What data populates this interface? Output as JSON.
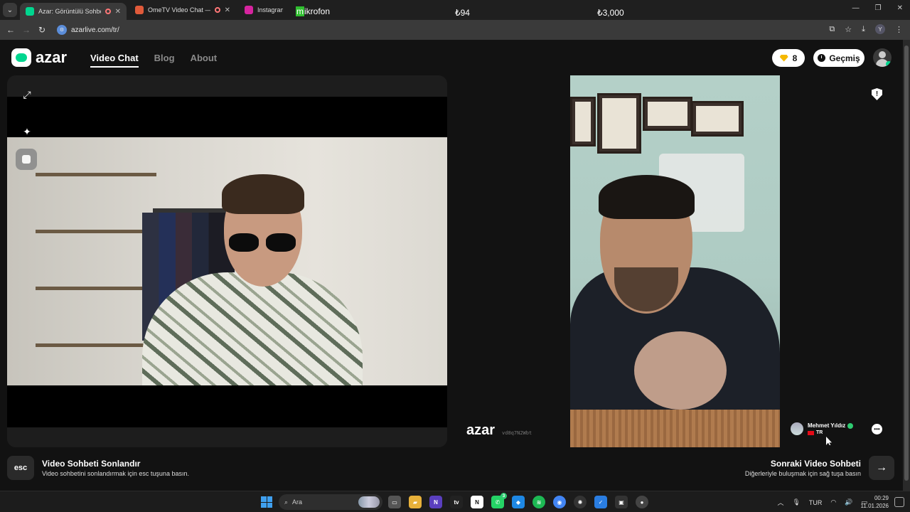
{
  "browser": {
    "tabs": [
      {
        "title": "Azar: Görüntülü Sohbet & Y",
        "favicon_color": "#00d68f",
        "active": true
      },
      {
        "title": "OmeTV Video Chat — Ome",
        "favicon_color": "#e05a3a",
        "active": false
      },
      {
        "title": "Instagram",
        "favicon_color": "#d6249f",
        "active": false
      }
    ],
    "overlay": {
      "mic_prefix": "m",
      "mic_rest": "ikrofon",
      "price_left": "₺94",
      "price_right": "₺3,000"
    },
    "url": "azarlive.com/tr/",
    "profile_initial": "Y"
  },
  "site": {
    "logo_text": "azar",
    "nav": [
      {
        "label": "Video Chat",
        "active": true
      },
      {
        "label": "Blog",
        "active": false
      },
      {
        "label": "About",
        "active": false
      }
    ],
    "gems": "8",
    "history_label": "Geçmiş"
  },
  "partner": {
    "name": "Mehmet Yıldız",
    "country": "TR",
    "watermark": "azar",
    "watermark_code": "vd8q7N2Wbt"
  },
  "bottom": {
    "esc_key": "esc",
    "end_title": "Video Sohbeti Sonlandır",
    "end_desc": "Video sohbetini sonlandırmak için esc tuşuna basın.",
    "next_title": "Sonraki Video Sohbeti",
    "next_desc": "Diğerleriyle buluşmak için sağ tuşa basın"
  },
  "taskbar": {
    "search_placeholder": "Ara",
    "language": "TUR",
    "time": "00:29",
    "date": "11.01.2026",
    "whatsapp_badge": "3"
  },
  "colors": {
    "accent": "#00d68f",
    "gem": "#f5b800"
  }
}
